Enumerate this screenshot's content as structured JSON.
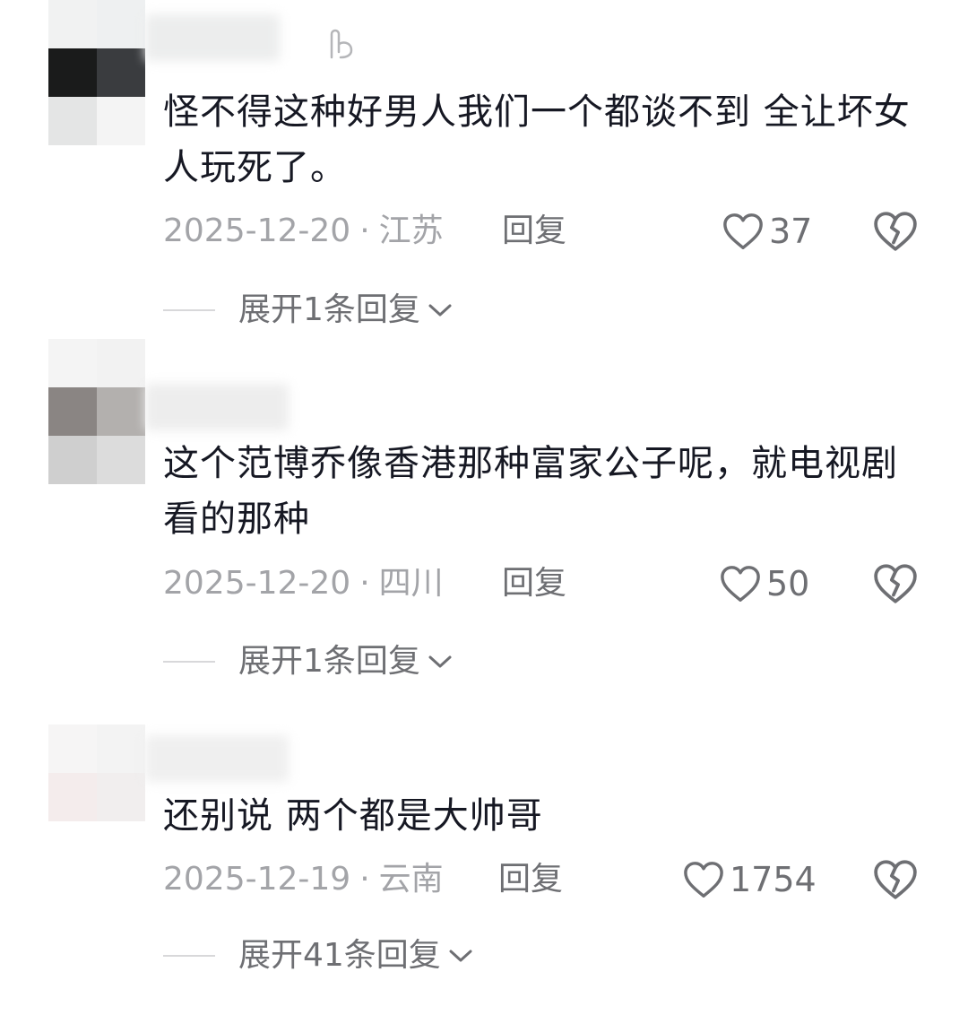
{
  "comments": [
    {
      "text": "怪不得这种好男人我们一个都谈不到 全让坏女人玩死了。",
      "date": "2025-12-20",
      "location": "江苏",
      "reply_label": "回复",
      "likes": "37",
      "expand_label": "展开1条回复"
    },
    {
      "text": "这个范博乔像香港那种富家公子呢，就电视剧看的那种",
      "date": "2025-12-20",
      "location": "四川",
      "reply_label": "回复",
      "likes": "50",
      "expand_label": "展开1条回复"
    },
    {
      "text": "还别说 两个都是大帅哥",
      "date": "2025-12-19",
      "location": "云南",
      "reply_label": "回复",
      "likes": "1754",
      "expand_label": "展开41条回复"
    }
  ],
  "meta_separator": "·",
  "icons": {
    "like": "heart-outline-icon",
    "dislike": "broken-heart-icon",
    "expand": "chevron-down-icon",
    "pin": "pin-icon"
  },
  "colors": {
    "text_primary": "#161823",
    "text_meta": "#a3a4a8",
    "text_secondary": "#6e6f73",
    "divider": "#d8d8da"
  }
}
